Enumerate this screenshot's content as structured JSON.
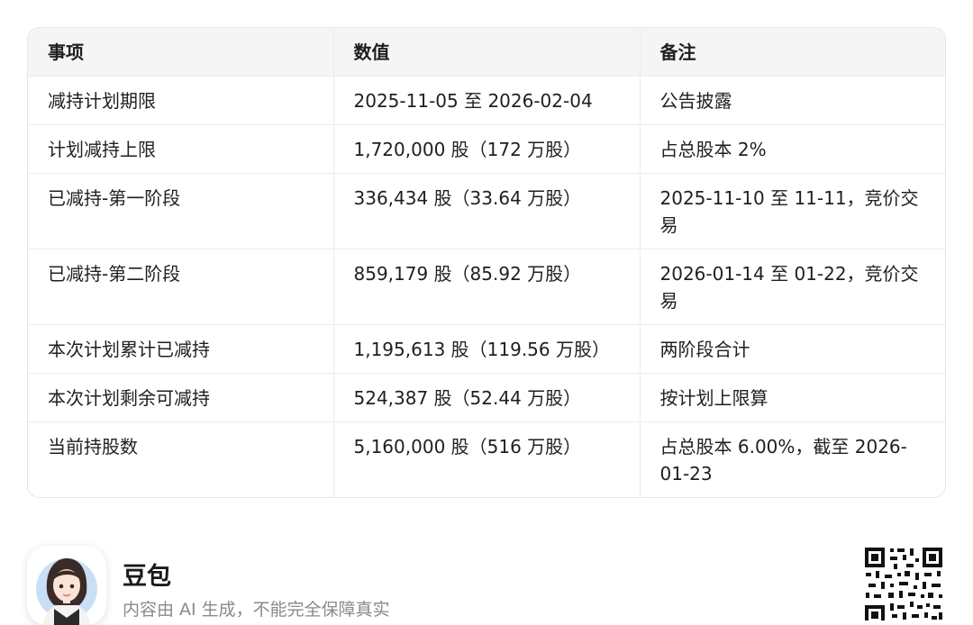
{
  "table": {
    "headers": [
      "事项",
      "数值",
      "备注"
    ],
    "rows": [
      [
        "减持计划期限",
        "2025-11-05 至 2026-02-04",
        "公告披露"
      ],
      [
        "计划减持上限",
        "1,720,000 股（172 万股）",
        "占总股本 2%"
      ],
      [
        "已减持-第一阶段",
        "336,434 股（33.64 万股）",
        "2025-11-10 至 11-11，竞价交易"
      ],
      [
        "已减持-第二阶段",
        "859,179 股（85.92 万股）",
        "2026-01-14 至 01-22，竞价交易"
      ],
      [
        "本次计划累计已减持",
        "1,195,613 股（119.56 万股）",
        "两阶段合计"
      ],
      [
        "本次计划剩余可减持",
        "524,387 股（52.44 万股）",
        "按计划上限算"
      ],
      [
        "当前持股数",
        "5,160,000 股（516 万股）",
        "占总股本 6.00%，截至 2026-01-23"
      ]
    ]
  },
  "footer": {
    "brand": "豆包",
    "disclaimer": "内容由 AI 生成，不能完全保障真实"
  },
  "icons": {
    "avatar": "assistant-avatar-icon",
    "qr": "qr-code-icon"
  }
}
